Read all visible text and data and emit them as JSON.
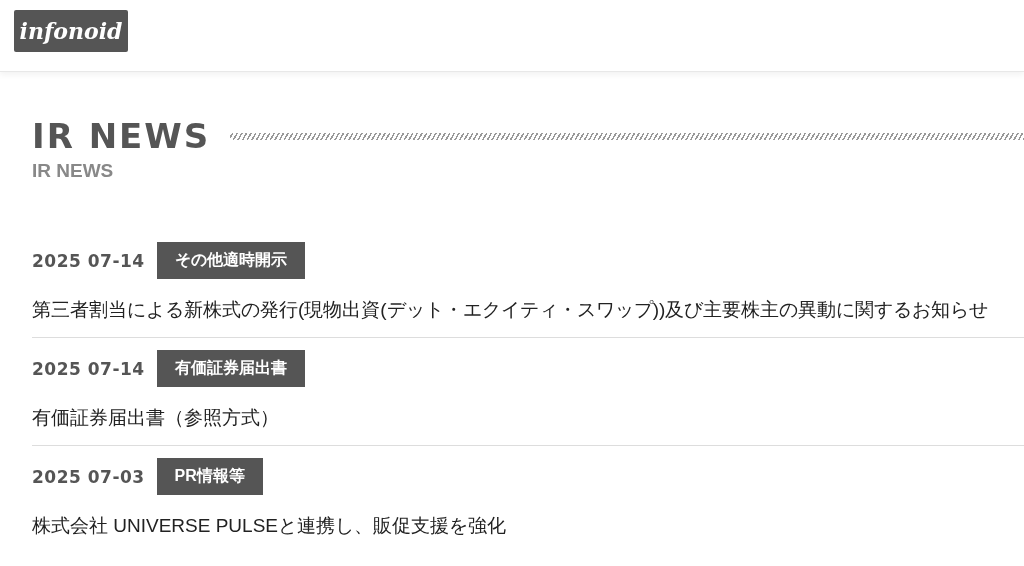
{
  "header": {
    "logo": "infonoid"
  },
  "section": {
    "title": "IR NEWS",
    "subtitle": "IR NEWS"
  },
  "news": [
    {
      "date": "2025 07-14",
      "category": "その他適時開示",
      "title": "第三者割当による新株式の発行(現物出資(デット・エクイティ・スワップ))及び主要株主の異動に関するお知らせ"
    },
    {
      "date": "2025 07-14",
      "category": "有価証券届出書",
      "title": "有価証券届出書（参照方式）"
    },
    {
      "date": "2025 07-03",
      "category": "PR情報等",
      "title": "株式会社 UNIVERSE PULSEと連携し、販促支援を強化"
    }
  ]
}
